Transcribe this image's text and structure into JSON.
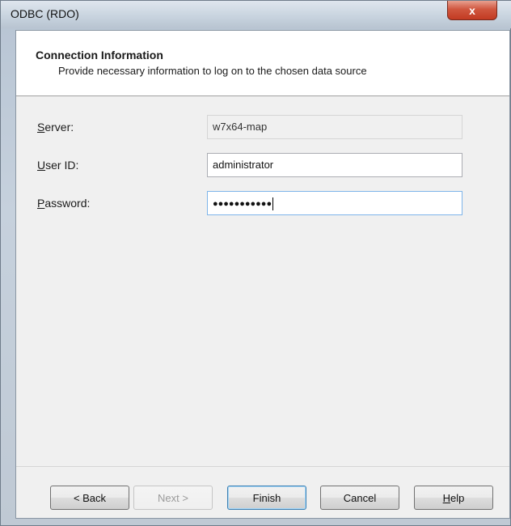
{
  "window": {
    "title": "ODBC (RDO)",
    "close_glyph": "x"
  },
  "header": {
    "title": "Connection Information",
    "subtitle": "Provide necessary information to log on to the chosen data source"
  },
  "form": {
    "server": {
      "label_first": "S",
      "label_rest": "erver:",
      "value": "w7x64-map"
    },
    "user_id": {
      "label_first": "U",
      "label_rest": "ser ID:",
      "value": "administrator"
    },
    "password": {
      "label_first": "P",
      "label_rest": "assword:",
      "value": "●●●●●●●●●●●"
    }
  },
  "buttons": {
    "back": "< Back",
    "next": "Next >",
    "finish": "Finish",
    "cancel": "Cancel",
    "help_first": "H",
    "help_rest": "elp"
  }
}
